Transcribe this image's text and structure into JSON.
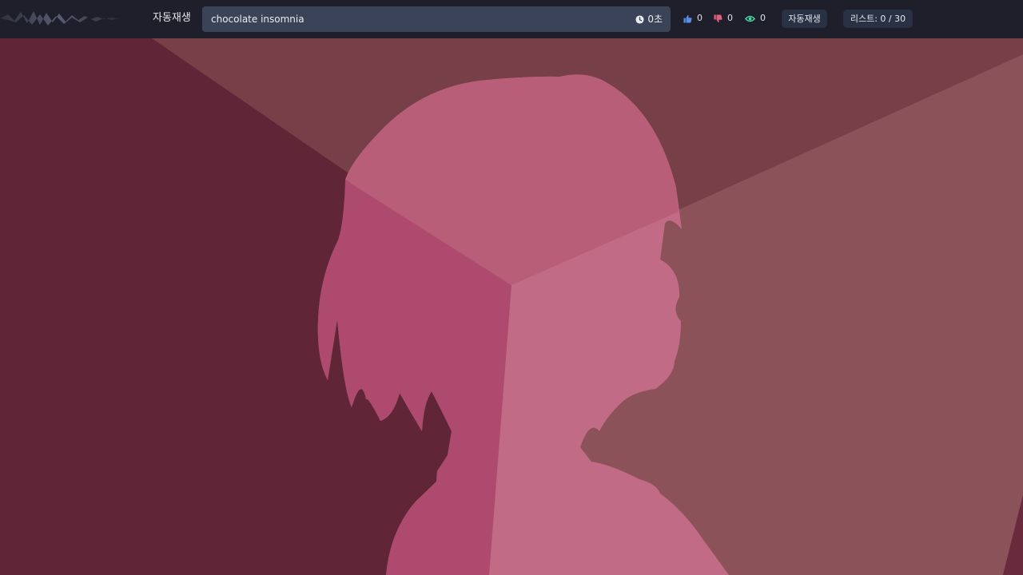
{
  "header": {
    "logo_icon": "waveform-logo-icon",
    "autoplay_label": "자동재생",
    "song_title": "chocolate insomnia",
    "timer": "0초",
    "timer_icon": "clock-icon",
    "likes": "0",
    "like_icon": "thumbs-up-icon",
    "dislikes": "0",
    "dislike_icon": "thumbs-down-icon",
    "views": "0",
    "views_icon": "eye-icon",
    "autoplay_button": "자동재생",
    "list_button": "리스트: 0 / 30"
  },
  "colors": {
    "header_bg": "#1e1f2b",
    "title_bar_bg": "#3a4357",
    "like": "#5b8fe6",
    "dislike": "#e0607a",
    "views": "#47d8a4",
    "art_dark": "#612538",
    "art_brown": "#773f47",
    "art_mauve": "#8b5359",
    "silhouette_light": "#c26b86",
    "silhouette_mid": "#ad4a6e"
  }
}
